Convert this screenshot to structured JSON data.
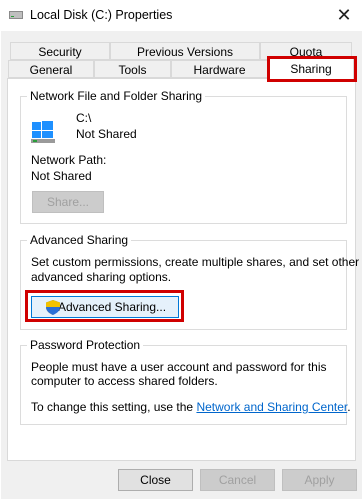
{
  "window": {
    "title": "Local Disk (C:) Properties",
    "close_glyph": "✕"
  },
  "tabs": {
    "row1": [
      "Security",
      "Previous Versions",
      "Quota"
    ],
    "row2": [
      "General",
      "Tools",
      "Hardware",
      "Sharing"
    ],
    "active": "Sharing"
  },
  "network_sharing": {
    "group_title": "Network File and Folder Sharing",
    "drive_path": "C:\\",
    "drive_status": "Not Shared",
    "network_path_label": "Network Path:",
    "network_path_value": "Not Shared",
    "share_button": "Share..."
  },
  "advanced_sharing": {
    "group_title": "Advanced Sharing",
    "description_line1": "Set custom permissions, create multiple shares, and set other",
    "description_line2": "advanced sharing options.",
    "button": "Advanced Sharing..."
  },
  "password_protection": {
    "group_title": "Password Protection",
    "line1": "People must have a user account and password for this",
    "line2": "computer to access shared folders.",
    "change_prefix": "To change this setting, use the ",
    "link_text": "Network and Sharing Center",
    "change_suffix": "."
  },
  "footer": {
    "close": "Close",
    "cancel": "Cancel",
    "apply": "Apply"
  },
  "colors": {
    "highlight": "#d00000",
    "link": "#0066cc",
    "windows_blue": "#1e90ff"
  }
}
